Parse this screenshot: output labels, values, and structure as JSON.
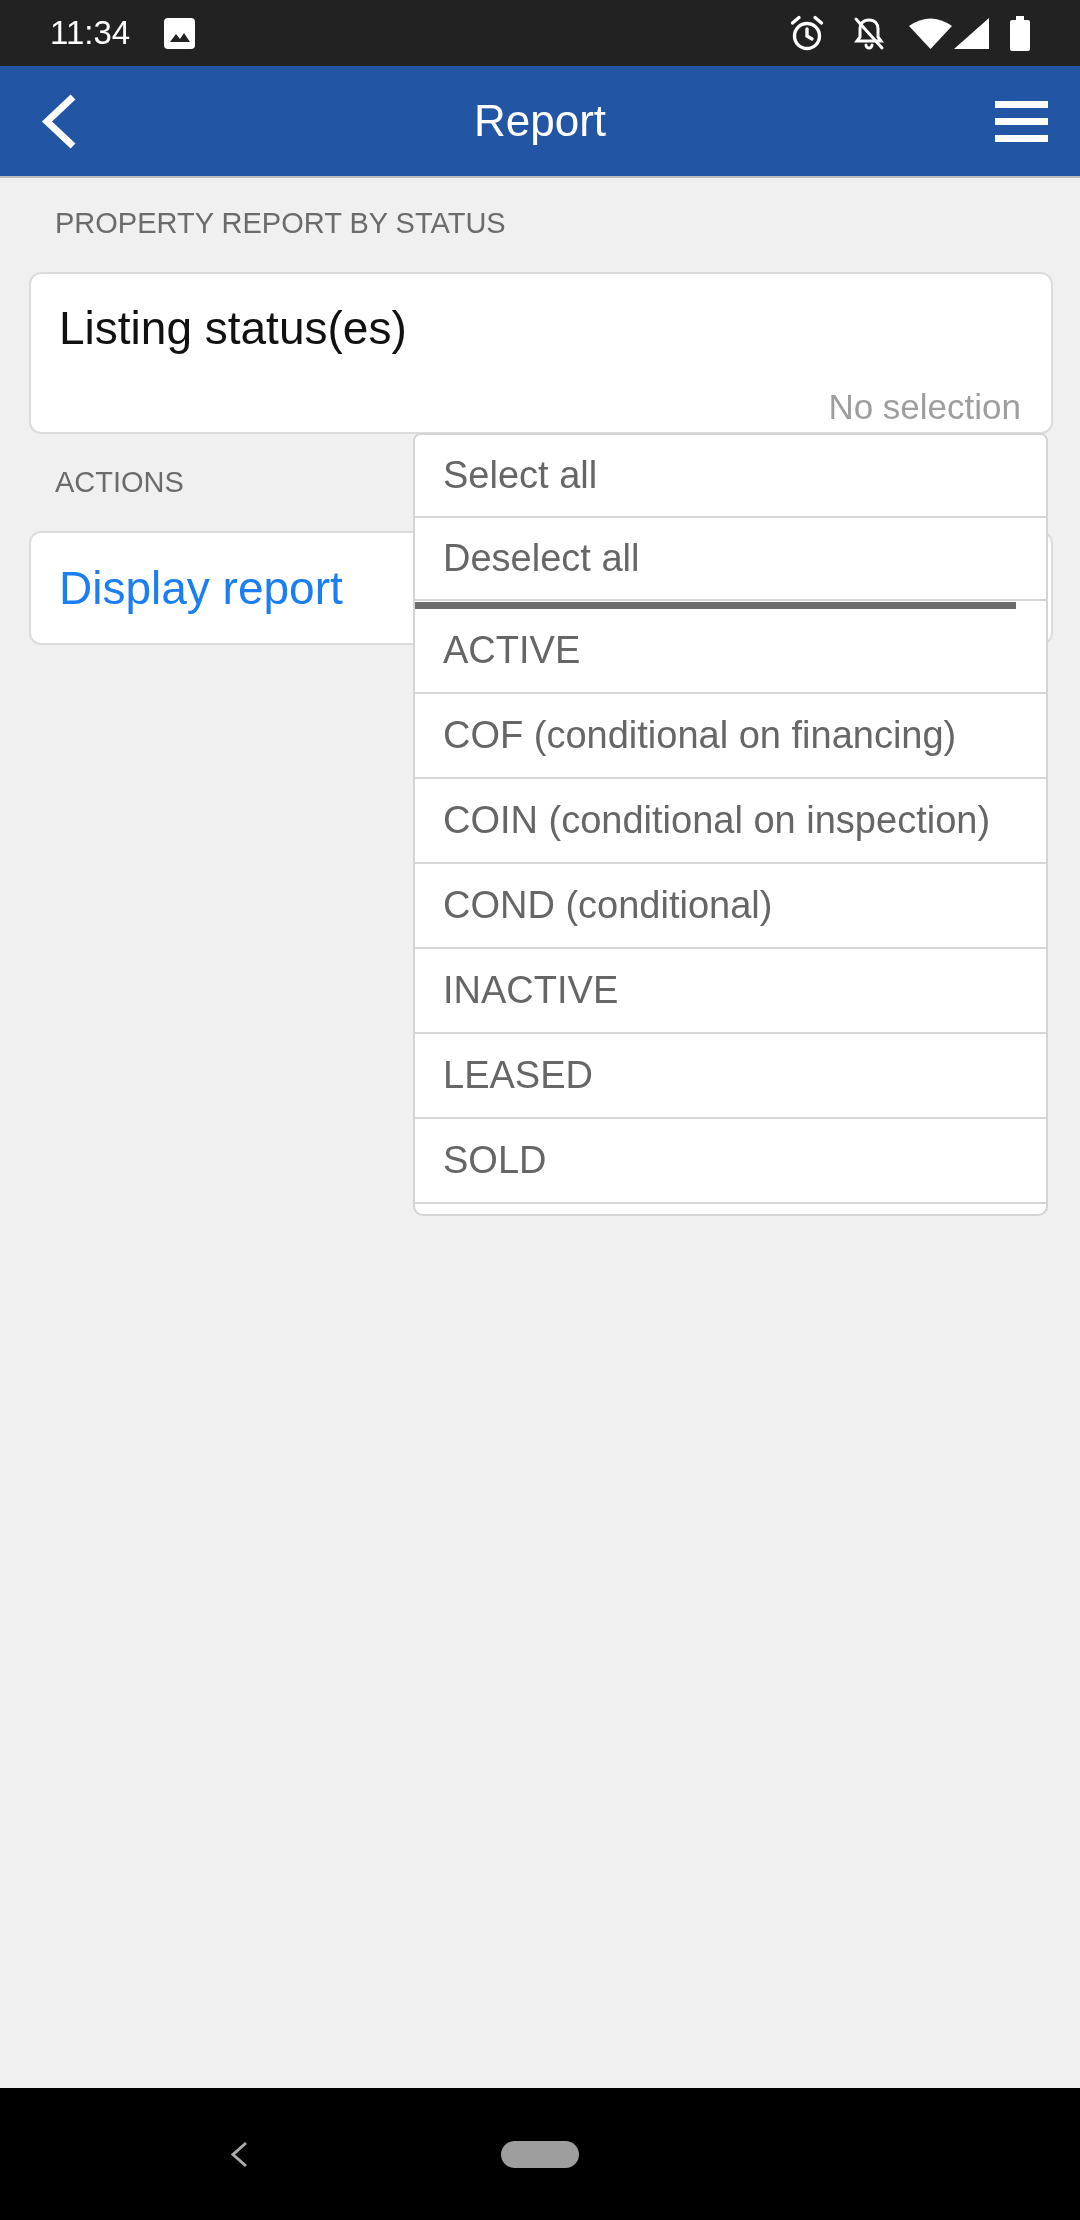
{
  "status_bar": {
    "time": "11:34"
  },
  "app_bar": {
    "title": "Report"
  },
  "report_section": {
    "heading": "PROPERTY REPORT BY STATUS",
    "field": {
      "label": "Listing status(es)",
      "value": "No selection"
    }
  },
  "actions_section": {
    "heading": "ACTIONS",
    "button": {
      "label": "Display report"
    }
  },
  "dropdown": {
    "commands": [
      {
        "label": "Select all"
      },
      {
        "label": "Deselect all"
      }
    ],
    "options": [
      {
        "label": "ACTIVE",
        "selected": false
      },
      {
        "label": "COF (conditional on financing)",
        "selected": false
      },
      {
        "label": "COIN (conditional on inspection)",
        "selected": false
      },
      {
        "label": "COND (conditional)",
        "selected": false
      },
      {
        "label": "INACTIVE",
        "selected": false
      },
      {
        "label": "LEASED",
        "selected": false
      },
      {
        "label": "SOLD",
        "selected": false
      }
    ]
  }
}
